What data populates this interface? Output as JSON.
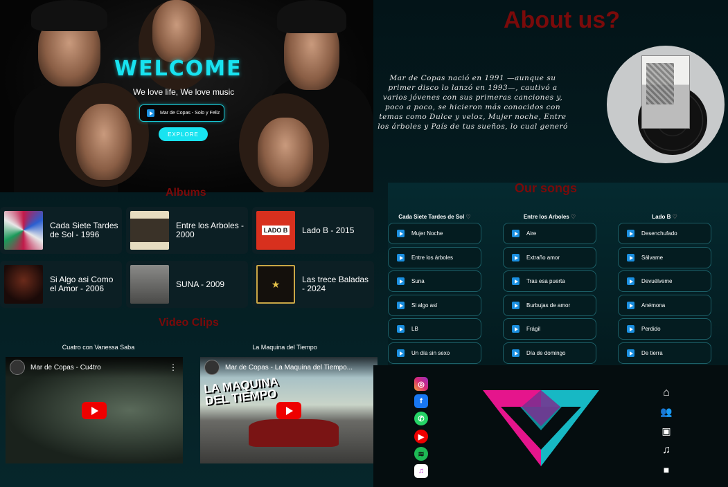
{
  "hero": {
    "title": "WELCOME",
    "subtitle": "We love life, We love music",
    "player_track": "Mar de Copas - Solo y Feliz",
    "explore_label": "EXPLORE"
  },
  "about": {
    "title": "About us?",
    "text": "Mar de Copas nació en 1991 —aunque su primer disco lo lanzó en 1993—, cautivó a varios jóvenes con sus primeras canciones y, poco a poco, se hicieron más conocidos con temas como Dulce y veloz, Mujer noche, Entre los árboles y País de tus sueños, lo cual generó"
  },
  "albums": {
    "title": "Albums",
    "items": [
      {
        "title": "Cada Siete Tardes de Sol - 1996"
      },
      {
        "title": "Entre los Arboles - 2000"
      },
      {
        "title": "Lado B - 2015"
      },
      {
        "title": "Si Algo asi Como el Amor - 2006"
      },
      {
        "title": "SUNA - 2009"
      },
      {
        "title": "Las trece Baladas - 2024"
      }
    ]
  },
  "videos": {
    "title": "Video Clips",
    "items": [
      {
        "label": "Cuatro con Vanessa Saba",
        "yt_title": "Mar de Copas - Cu4tro"
      },
      {
        "label": "La Maquina del Tiempo",
        "yt_title": "Mar de Copas - La Maquina del Tiempo...",
        "overlay": "LA MAQUINA DEL TIEMPO"
      }
    ]
  },
  "songs": {
    "title": "Our songs",
    "columns": [
      {
        "header": "Cada Siete Tardes de Sol",
        "tracks": [
          "Mujer Noche",
          "Entre los árboles",
          "Suna",
          "Si algo así",
          "LB",
          "Un día sin sexo"
        ]
      },
      {
        "header": "Entre los Arboles",
        "tracks": [
          "Aire",
          "Extraño amor",
          "Tras esa puerta",
          "Burbujas de amor",
          "Frágil",
          "Día de domingo"
        ]
      },
      {
        "header": "Lado B",
        "tracks": [
          "Desenchufado",
          "Sálvame",
          "Devuélveme",
          "Anémona",
          "Perdido",
          "De tierra"
        ]
      }
    ]
  },
  "footer": {
    "social": [
      "instagram-icon",
      "facebook-icon",
      "whatsapp-icon",
      "youtube-icon",
      "spotify-icon",
      "itunes-icon"
    ],
    "nav": [
      "home-icon",
      "users-icon",
      "images-icon",
      "music-icon",
      "video-icon"
    ]
  },
  "colors": {
    "accent_cyan": "#18e3f0",
    "section_title_red": "#7a0a0a",
    "logo_pink": "#e5158c",
    "logo_teal": "#17b8c4"
  }
}
